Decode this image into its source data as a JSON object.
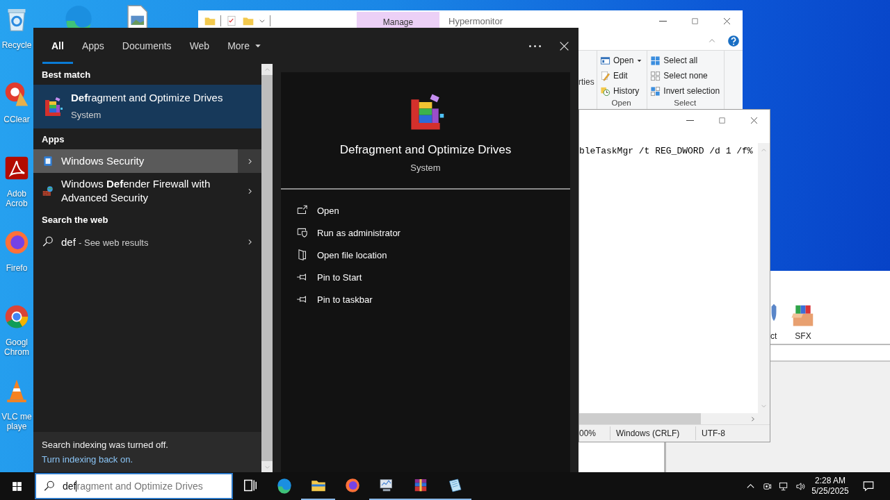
{
  "desktop": {
    "shortcuts": [
      {
        "kind": "recycle-bin",
        "lines": [
          "Recycle"
        ]
      },
      {
        "kind": "cleaner",
        "lines": [
          "CClear"
        ]
      },
      {
        "kind": "pdf",
        "lines": [
          "Adob",
          "Acrob"
        ]
      },
      {
        "kind": "firefox",
        "lines": [
          "Firefo"
        ]
      },
      {
        "kind": "chrome",
        "lines": [
          "Googl",
          "Chrom"
        ]
      },
      {
        "kind": "vlc",
        "lines": [
          "VLC me",
          "playe"
        ]
      }
    ],
    "top_icons": [
      {
        "kind": "edge"
      },
      {
        "kind": "image-file"
      }
    ]
  },
  "explorer_window": {
    "context_tab": "Manage",
    "title": "Hypermonitor",
    "ribbon": {
      "partial_label": "rties",
      "groups": [
        {
          "label": "Open",
          "items": [
            {
              "label": "Open",
              "kind": "open",
              "dropdown": true
            },
            {
              "label": "Edit",
              "kind": "edit",
              "dropdown": false
            },
            {
              "label": "History",
              "kind": "history",
              "dropdown": false
            }
          ]
        },
        {
          "label": "Select",
          "items": [
            {
              "label": "Select all",
              "kind": "select-all",
              "dropdown": false
            },
            {
              "label": "Select none",
              "kind": "select-none",
              "dropdown": false
            },
            {
              "label": "Invert selection",
              "kind": "invert",
              "dropdown": false
            }
          ]
        }
      ]
    }
  },
  "editor_window": {
    "text": "bleTaskMgr /t REG_DWORD /d 1 /f%",
    "status": [
      "00%",
      "Windows (CRLF)",
      "UTF-8"
    ]
  },
  "background_window": {
    "tools": [
      {
        "label": "ct",
        "kind": "shield"
      },
      {
        "label": "SFX",
        "kind": "sfx"
      }
    ]
  },
  "search": {
    "tabs": [
      {
        "label": "All",
        "selected": true,
        "has_menu": false
      },
      {
        "label": "Apps",
        "selected": false,
        "has_menu": false
      },
      {
        "label": "Documents",
        "selected": false,
        "has_menu": false
      },
      {
        "label": "Web",
        "selected": false,
        "has_menu": false
      },
      {
        "label": "More",
        "selected": false,
        "has_menu": true
      }
    ],
    "sections": [
      {
        "heading": "Best match",
        "items": [
          {
            "kind": "defrag",
            "title": "**Def**ragment and Optimize Drives",
            "subtitle": "System",
            "selected": true,
            "hovered": false,
            "expandable": false
          }
        ]
      },
      {
        "heading": "Apps",
        "items": [
          {
            "kind": "security",
            "title": "Windows Security",
            "selected": false,
            "hovered": true,
            "expandable": true
          },
          {
            "kind": "firewall",
            "title": "Windows **Def**ender Firewall with Advanced Security",
            "selected": false,
            "hovered": false,
            "expandable": true
          }
        ]
      },
      {
        "heading": "Search the web",
        "items": [
          {
            "kind": "web",
            "query": "def",
            "hint": "- See web results",
            "selected": false,
            "hovered": false,
            "expandable": true
          }
        ]
      }
    ],
    "preview": {
      "kind": "defrag",
      "title": "Defragment and Optimize Drives",
      "subtitle": "System",
      "actions": [
        {
          "label": "Open",
          "kind": "open-external"
        },
        {
          "label": "Run as administrator",
          "kind": "admin"
        },
        {
          "label": "Open file location",
          "kind": "file-location"
        },
        {
          "label": "Pin to Start",
          "kind": "pin"
        },
        {
          "label": "Pin to taskbar",
          "kind": "pin"
        }
      ]
    },
    "footer": {
      "text": "Search indexing was turned off.",
      "link": "Turn indexing back on."
    }
  },
  "taskbar": {
    "search": {
      "value": "def",
      "suggestion": "ragment and Optimize Drives"
    },
    "apps": [
      {
        "kind": "task-view",
        "running": false
      },
      {
        "kind": "edge",
        "running": false
      },
      {
        "kind": "explorer",
        "running": true
      },
      {
        "kind": "firefox",
        "running": false
      },
      {
        "kind": "monitor-app",
        "running": true
      },
      {
        "kind": "winrar",
        "running": true
      },
      {
        "kind": "notepad",
        "running": true
      }
    ],
    "time": "2:28 AM",
    "date": "5/25/2025"
  }
}
